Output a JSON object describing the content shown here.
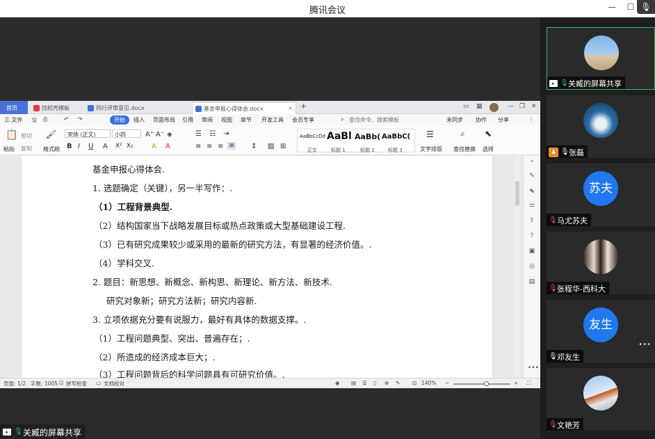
{
  "window": {
    "title": "腾讯会议"
  },
  "share_label": "关臧的屏幕共享",
  "wps": {
    "tabs": [
      {
        "label": "首页"
      },
      {
        "label": "找稻壳模板"
      },
      {
        "label": "同行评审意见.docx"
      },
      {
        "label": "基金申报心得体会.docx"
      }
    ],
    "new_tab": "+",
    "menu": {
      "file": "三 文件",
      "items": [
        "开始",
        "插入",
        "页面布局",
        "引用",
        "审阅",
        "视图",
        "章节",
        "开发工具",
        "会员专享"
      ],
      "search": "查找命令、搜索模板",
      "sync": "未同步",
      "collab": "协作",
      "share": "分享"
    },
    "ribbon": {
      "paste": "粘贴",
      "cut": "剪切",
      "copy": "复制",
      "format_painter": "格式刷",
      "font_name": "宋体 (正文)",
      "font_size": "小四",
      "styles": [
        {
          "preview": "AaBbCcDd",
          "label": "正文"
        },
        {
          "preview": "AaBl",
          "label": "标题 1"
        },
        {
          "preview": "AaBb(",
          "label": "标题 2"
        },
        {
          "preview": "AaBbC(",
          "label": "标题 3"
        }
      ],
      "text_layout": "文字排版",
      "find_replace": "查找替换",
      "select": "选择"
    },
    "document": {
      "lines": [
        "基金申报心得体会.",
        "1. 选题确定（关键），另一半写作：.",
        "（1）工程背景典型.",
        "（2）结构国家当下战略发展目标或热点政策或大型基础建设工程.",
        "（3）已有研究成果较少或采用的最新的研究方法，有显著的经济价值。.",
        "（4）学科交叉.",
        "2. 题目：新思想、新概念、新构思、新理论、新方法、新技术.",
        "研究对象新；研究方法新；研究内容新.",
        "3. 立项依据充分要有说服力，最好有具体的数据支撑。.",
        "（1）工程问题典型、突出、普遍存在；.",
        "（2）所造成的经济成本巨大；.",
        "（3）工程问题背后的科学问题具有可研究价值。."
      ]
    },
    "status": {
      "page": "页面: 1/2",
      "words": "字数: 1005",
      "spell": "拼写检查",
      "proof": "文档校对",
      "zoom": "140%"
    }
  },
  "participants": [
    {
      "name": "关臧的屏幕共享",
      "type": "photo-beach"
    },
    {
      "name": "张磊",
      "type": "photo-lake"
    },
    {
      "name": "马尤苏夫",
      "avatar_text": "苏夫"
    },
    {
      "name": "张程华-西科大",
      "type": "photo-people"
    },
    {
      "name": "邓友生",
      "avatar_text": "友生"
    },
    {
      "name": "文艳芳",
      "type": "photo-jump"
    }
  ],
  "more": "•••",
  "colors": {
    "accent": "#3b6fe0",
    "mic_on": "#2fbf71",
    "avatar_blue": "#1f78f0"
  }
}
